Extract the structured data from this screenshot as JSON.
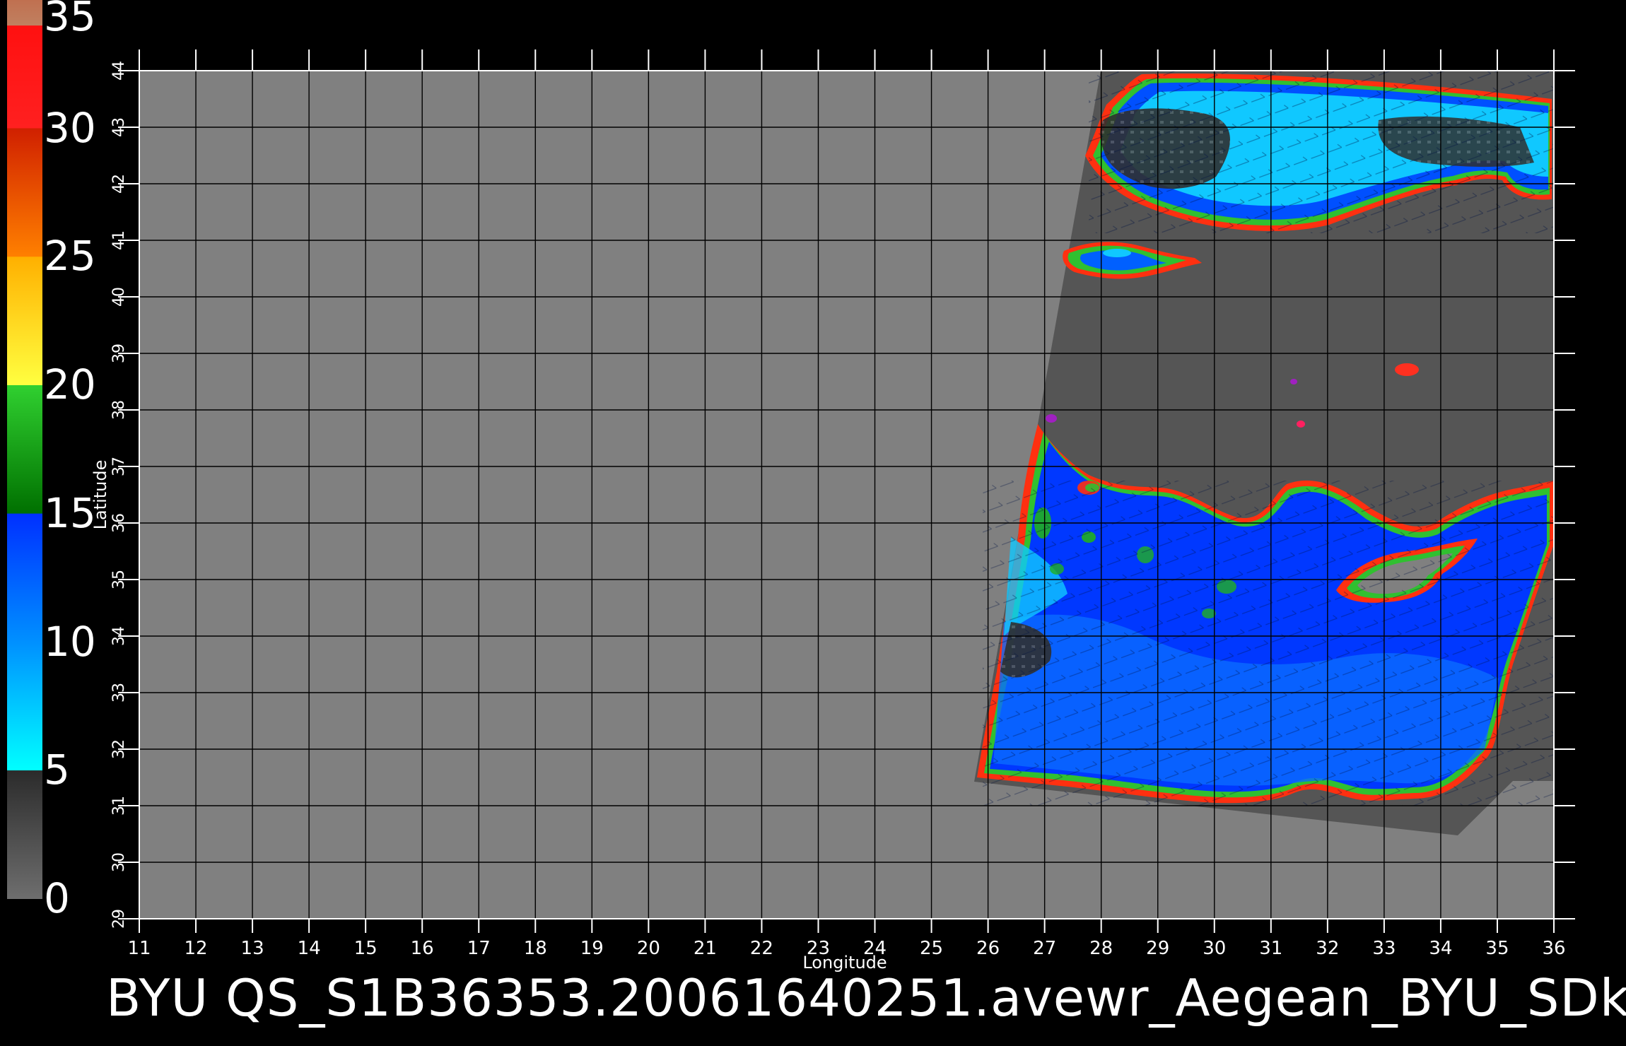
{
  "caption": "BYU QS_S1B36353.20061640251.avewr_Aegean_BYU_SDk",
  "chart_data": {
    "type": "heatmap",
    "xlabel": "Longitude",
    "ylabel": "Latitude",
    "xlim": [
      11,
      36
    ],
    "ylim": [
      29,
      44
    ],
    "x_ticks": [
      11,
      12,
      13,
      14,
      15,
      16,
      17,
      18,
      19,
      20,
      21,
      22,
      23,
      24,
      25,
      26,
      27,
      28,
      29,
      30,
      31,
      32,
      33,
      34,
      35,
      36
    ],
    "y_ticks": [
      29,
      30,
      31,
      32,
      33,
      34,
      35,
      36,
      37,
      38,
      39,
      40,
      41,
      42,
      43,
      44
    ],
    "grid": true,
    "colorbar": {
      "labels": [
        0,
        5,
        10,
        15,
        20,
        25,
        30,
        35
      ],
      "range": [
        0,
        35
      ],
      "stops": [
        {
          "value": 0,
          "color": "#6e6e6e"
        },
        {
          "value": 5,
          "color": "#2b2b2b"
        },
        {
          "value": 5.01,
          "color": "#00ffff"
        },
        {
          "value": 10,
          "color": "#0090ff"
        },
        {
          "value": 15,
          "color": "#0030ff"
        },
        {
          "value": 15.01,
          "color": "#007000"
        },
        {
          "value": 20,
          "color": "#30d030"
        },
        {
          "value": 20.01,
          "color": "#ffff40"
        },
        {
          "value": 25,
          "color": "#ffb000"
        },
        {
          "value": 25.01,
          "color": "#ff8000"
        },
        {
          "value": 30,
          "color": "#d02000"
        },
        {
          "value": 30.01,
          "color": "#ff2020"
        },
        {
          "value": 34,
          "color": "#ff1010"
        },
        {
          "value": 34.01,
          "color": "#c08060"
        },
        {
          "value": 35,
          "color": "#c07050"
        }
      ]
    },
    "colors": {
      "background_gray": "#808080",
      "swath_gray": "#555555",
      "land_dark": "#3a3a3a",
      "grid_line": "#000000"
    }
  }
}
